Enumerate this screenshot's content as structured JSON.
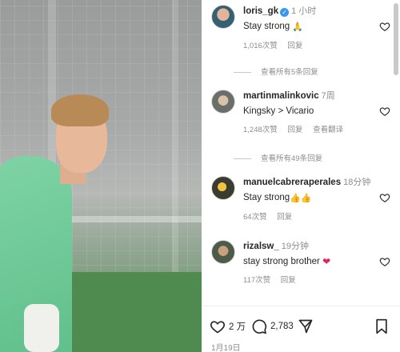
{
  "comments": [
    {
      "username": "loris_gk",
      "verified": true,
      "time": "1 小时",
      "text": "Stay strong",
      "emoji": "🙏",
      "likes": "1,016次赞",
      "reply": "回复"
    },
    {
      "username": "martinmalinkovic",
      "time": "7周",
      "text": "Kingsky > Vicario",
      "likes": "1,248次赞",
      "reply": "回复",
      "translate": "查看翻译"
    },
    {
      "username": "manuelcabreraperales",
      "time": "18分钟",
      "text": "Stay strong",
      "emoji": "👍👍",
      "likes": "64次赞",
      "reply": "回复"
    },
    {
      "username": "rizalsw_",
      "time": "19分钟",
      "text": "stay strong brother",
      "emoji": "❤",
      "likes": "117次赞",
      "reply": "回复"
    }
  ],
  "view_replies": [
    "查看所有5条回复",
    "查看所有49条回复"
  ],
  "actions": {
    "likes_count": "2 万",
    "comments_count": "2,783"
  },
  "date": "1月19日",
  "colors": {
    "verified_blue": "#3897f0",
    "muted_text": "#8e8e8e",
    "heart_red": "#e0245e"
  }
}
